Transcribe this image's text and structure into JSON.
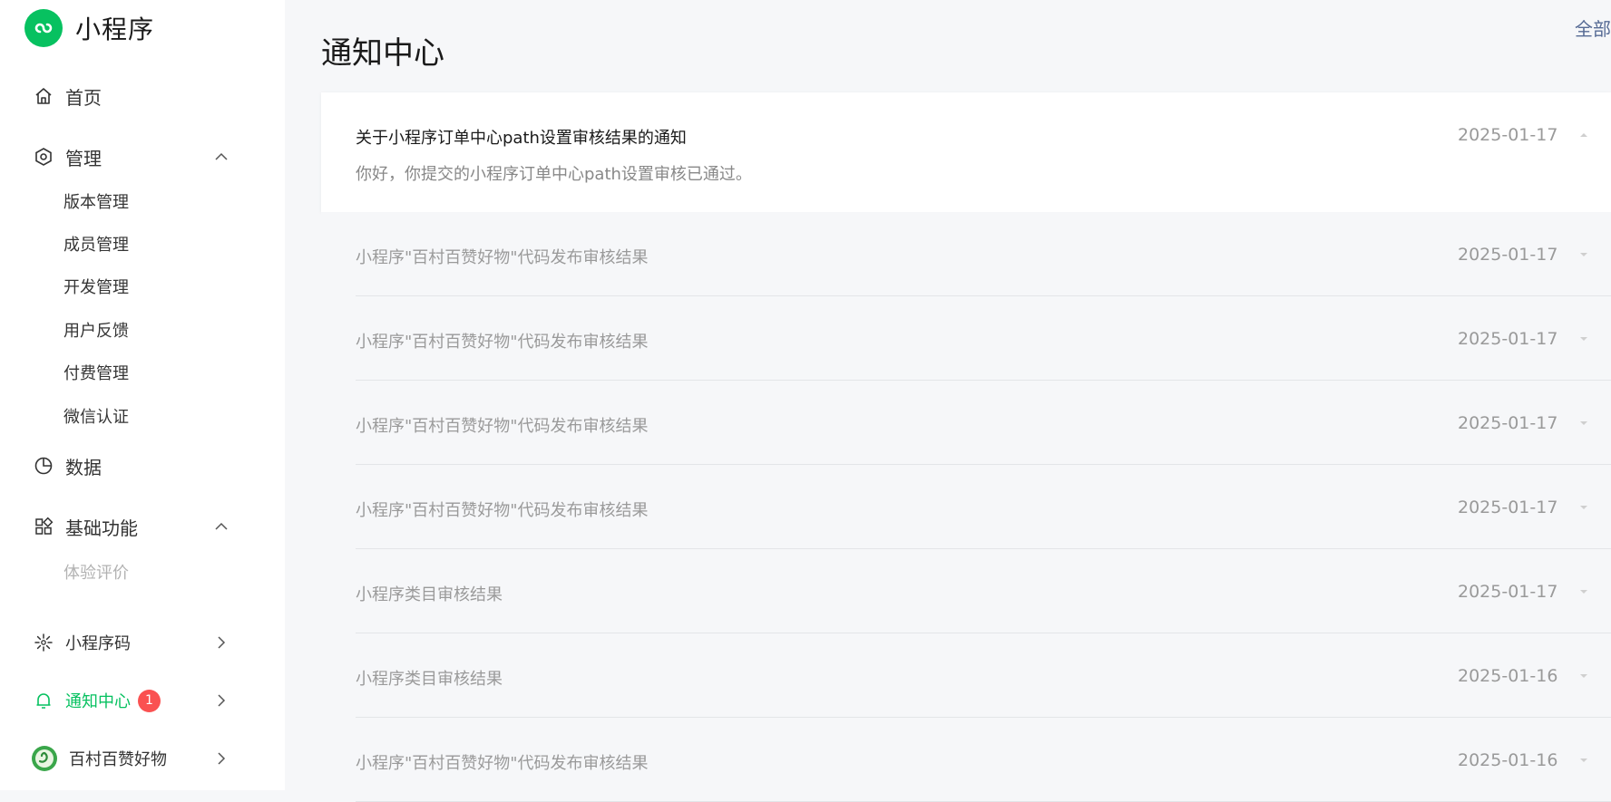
{
  "brand": {
    "title": "小程序"
  },
  "sidebar": {
    "items": [
      {
        "label": "首页",
        "icon": "home-icon"
      },
      {
        "label": "管理",
        "icon": "hexagon-icon",
        "expanded": true,
        "children": [
          "版本管理",
          "成员管理",
          "开发管理",
          "用户反馈",
          "付费管理",
          "微信认证"
        ]
      },
      {
        "label": "数据",
        "icon": "pie-chart-icon"
      },
      {
        "label": "基础功能",
        "icon": "grid-icon",
        "expanded": true,
        "children": [
          "体验评价"
        ]
      },
      {
        "label": "小程序码",
        "icon": "code-icon"
      },
      {
        "label": "通知中心",
        "icon": "bell-icon",
        "badge": "1",
        "active": true
      },
      {
        "label": "百村百赞好物",
        "icon": "avatar"
      }
    ]
  },
  "main": {
    "title": "通知中心",
    "filter_label": "全部",
    "expanded": {
      "title": "关于小程序订单中心path设置审核结果的通知",
      "desc": "你好，你提交的小程序订单中心path设置审核已通过。",
      "date": "2025-01-17"
    },
    "rows": [
      {
        "title": "小程序\"百村百赞好物\"代码发布审核结果",
        "date": "2025-01-17"
      },
      {
        "title": "小程序\"百村百赞好物\"代码发布审核结果",
        "date": "2025-01-17"
      },
      {
        "title": "小程序\"百村百赞好物\"代码发布审核结果",
        "date": "2025-01-17"
      },
      {
        "title": "小程序\"百村百赞好物\"代码发布审核结果",
        "date": "2025-01-17"
      },
      {
        "title": "小程序类目审核结果",
        "date": "2025-01-17"
      },
      {
        "title": "小程序类目审核结果",
        "date": "2025-01-16"
      },
      {
        "title": "小程序\"百村百赞好物\"代码发布审核结果",
        "date": "2025-01-16"
      }
    ]
  },
  "colors": {
    "accent": "#07c160",
    "badge": "#fa5151",
    "link": "#576b95"
  }
}
